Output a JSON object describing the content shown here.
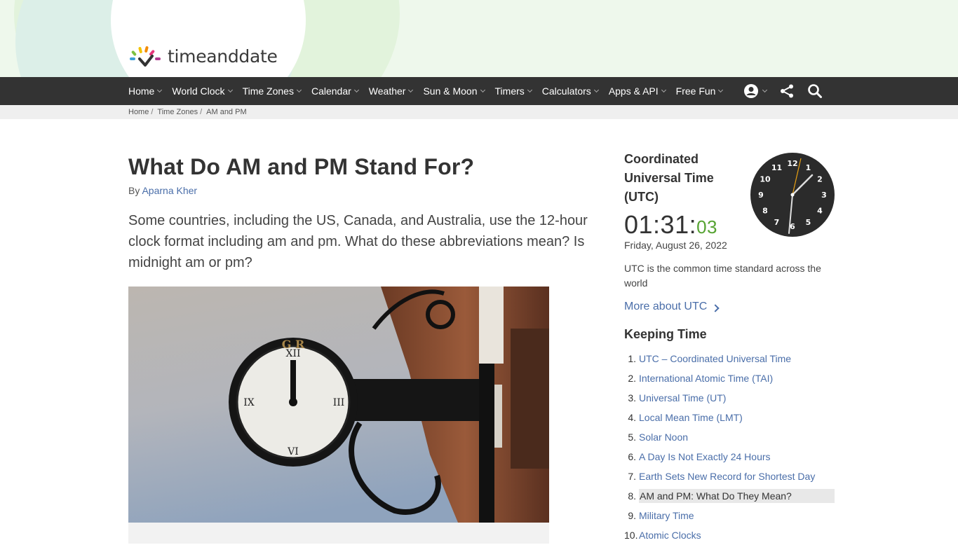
{
  "site": {
    "logo_text": "timeanddate"
  },
  "nav": {
    "items": [
      {
        "label": "Home"
      },
      {
        "label": "World Clock"
      },
      {
        "label": "Time Zones"
      },
      {
        "label": "Calendar"
      },
      {
        "label": "Weather"
      },
      {
        "label": "Sun & Moon"
      },
      {
        "label": "Timers"
      },
      {
        "label": "Calculators"
      },
      {
        "label": "Apps & API"
      },
      {
        "label": "Free Fun"
      }
    ],
    "icons": [
      "account-icon",
      "share-icon",
      "search-icon"
    ]
  },
  "breadcrumb": [
    {
      "label": "Home"
    },
    {
      "label": "Time Zones"
    },
    {
      "label": "AM and PM"
    }
  ],
  "article": {
    "title": "What Do AM and PM Stand For?",
    "by_prefix": "By",
    "author": "Aparna Kher",
    "intro": "Some countries, including the US, Canada, and Australia, use the 12-hour clock format including am and pm. What do these abbreviations mean? Is midnight am or pm?"
  },
  "sidebar": {
    "utc_title": "Coordinated Universal Time (UTC)",
    "time_hm": "01:31:",
    "time_s": "03",
    "date": "Friday, August 26, 2022",
    "description": "UTC is the common time standard across the world",
    "more_link": "More about UTC",
    "clock_numbers": [
      "12",
      "1",
      "2",
      "3",
      "4",
      "5",
      "6",
      "7",
      "8",
      "9",
      "10",
      "11"
    ],
    "keeping_time_title": "Keeping Time",
    "keeping_time": [
      {
        "num": "1.",
        "label": "UTC – Coordinated Universal Time"
      },
      {
        "num": "2.",
        "label": "International Atomic Time (TAI)"
      },
      {
        "num": "3.",
        "label": "Universal Time (UT)"
      },
      {
        "num": "4.",
        "label": "Local Mean Time (LMT)"
      },
      {
        "num": "5.",
        "label": "Solar Noon"
      },
      {
        "num": "6.",
        "label": "A Day Is Not Exactly 24 Hours"
      },
      {
        "num": "7.",
        "label": "Earth Sets New Record for Shortest Day"
      },
      {
        "num": "8.",
        "label": "AM and PM: What Do They Mean?"
      },
      {
        "num": "9.",
        "label": "Military Time"
      },
      {
        "num": "10.",
        "label": "Atomic Clocks"
      }
    ],
    "active_index": 7
  },
  "colors": {
    "nav_bg": "#333333",
    "link": "#4a6ea9",
    "seconds": "#56a332",
    "clock_face": "#2b2b2b",
    "second_hand": "#e8a013"
  }
}
